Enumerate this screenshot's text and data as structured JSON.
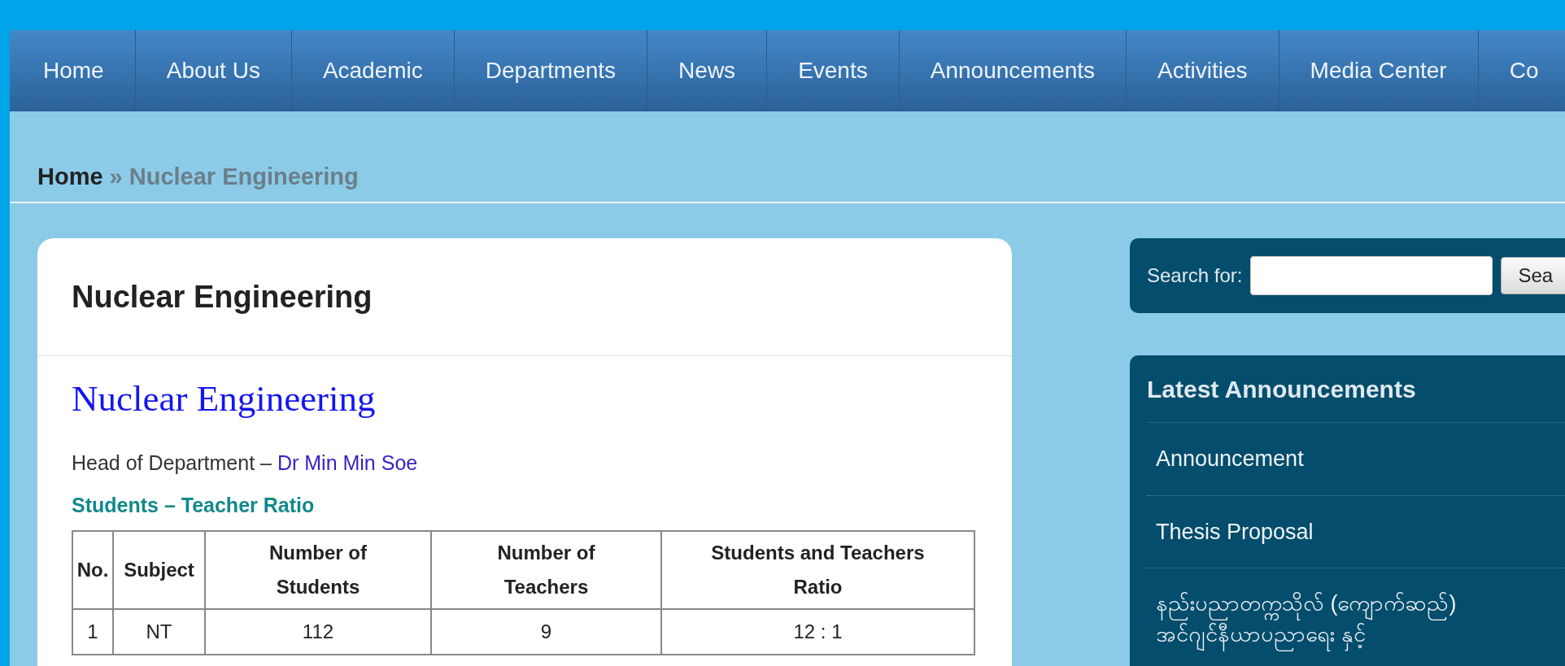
{
  "nav": [
    {
      "label": "Home"
    },
    {
      "label": "About Us"
    },
    {
      "label": "Academic"
    },
    {
      "label": "Departments"
    },
    {
      "label": "News"
    },
    {
      "label": "Events"
    },
    {
      "label": "Announcements"
    },
    {
      "label": "Activities"
    },
    {
      "label": "Media Center"
    },
    {
      "label": "Co"
    }
  ],
  "breadcrumb": {
    "home": "Home",
    "separator": "»",
    "current": "Nuclear Engineering"
  },
  "card": {
    "title": "Nuclear Engineering",
    "heading": "Nuclear Engineering",
    "head_label": "Head of Department –",
    "head_name": "Dr Min Min Soe",
    "table_title": "Students – Teacher Ratio",
    "table": {
      "columns": [
        "No.",
        "Subject",
        "Number of Students",
        "Number of Teachers",
        "Students and Teachers Ratio"
      ],
      "rows": [
        [
          "1",
          "NT",
          "112",
          "9",
          "12 : 1"
        ]
      ]
    }
  },
  "search": {
    "label": "Search for:",
    "button": "Sea"
  },
  "announcements": {
    "title": "Latest Announcements",
    "items": [
      "Announcement",
      "Thesis Proposal",
      "နည်းပညာတက္ကသိုလ် (ကျောက်ဆည်) အင်ဂျင်နီယာပညာရေး နှင့်"
    ]
  }
}
